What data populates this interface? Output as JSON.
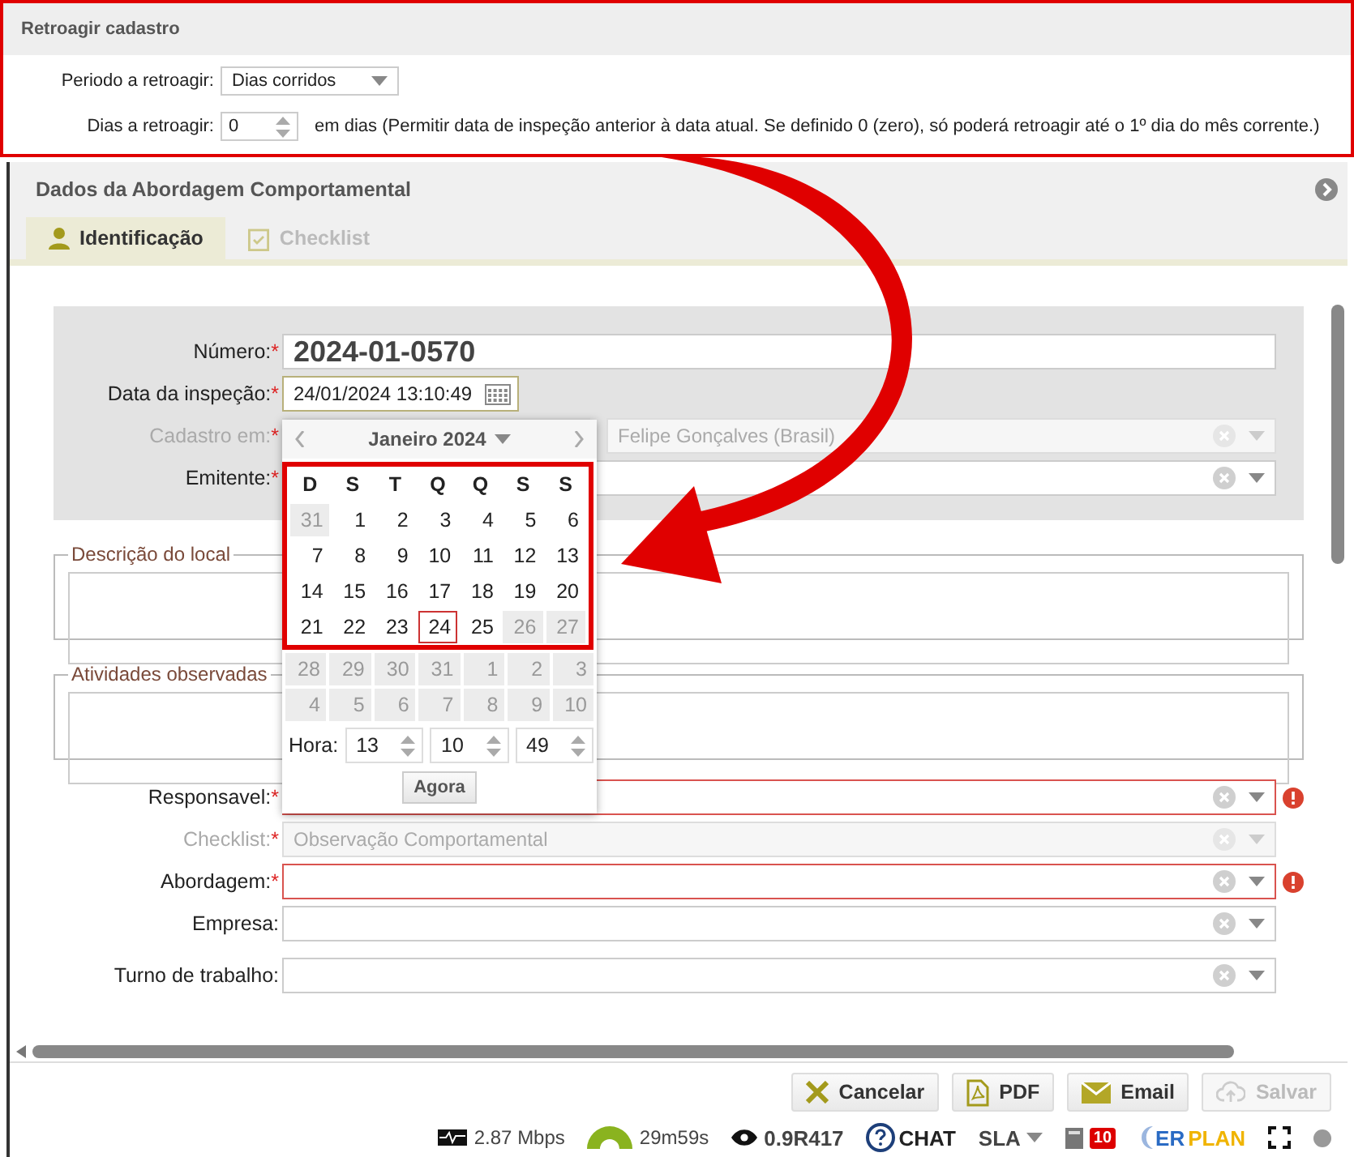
{
  "retro_panel": {
    "title": "Retroagir cadastro",
    "period_label": "Periodo a retroagir:",
    "period_value": "Dias corridos",
    "days_label": "Dias a retroagir:",
    "days_value": "0",
    "days_hint": "em dias (Permitir data de inspeção anterior à data atual. Se definido 0 (zero), só poderá retroagir até o 1º dia do mês corrente.)"
  },
  "panel": {
    "title": "Dados da Abordagem Comportamental"
  },
  "tabs": [
    {
      "label": "Identificação",
      "selected": true,
      "disabled": false
    },
    {
      "label": "Checklist",
      "selected": false,
      "disabled": true
    }
  ],
  "top_fields": [
    {
      "label": "Número:",
      "required_mark": "*",
      "disabled": false,
      "kind": "number",
      "value": "2024-01-0570"
    },
    {
      "label": "Data da inspeção:",
      "required_mark": "*",
      "disabled": false,
      "kind": "date",
      "value": "24/01/2024 13:10:49"
    },
    {
      "label": "Cadastro em:",
      "required_mark": "*",
      "disabled": true,
      "kind": "pair",
      "value": "Felipe Gonçalves (Brasil)"
    },
    {
      "label": "Emitente:",
      "required_mark": "*",
      "disabled": false,
      "kind": "select"
    }
  ],
  "fieldsets": [
    {
      "legend": "Descrição do local"
    },
    {
      "legend": "Atividades observadas"
    }
  ],
  "bottom_fields": [
    {
      "label": "Responsavel:",
      "required_mark": "*",
      "disabled": false,
      "error": true,
      "kind": "select"
    },
    {
      "label": "Checklist:",
      "required_mark": "*",
      "disabled": true,
      "error": false,
      "kind": "select",
      "value": "Observação Comportamental"
    },
    {
      "label": "Abordagem:",
      "required_mark": "*",
      "disabled": false,
      "error": true,
      "kind": "select"
    },
    {
      "label": "Empresa:",
      "disabled": false,
      "error": false,
      "kind": "select"
    },
    {
      "label": "Turno de trabalho:",
      "disabled": false,
      "error": false,
      "kind": "select"
    }
  ],
  "calendar": {
    "month": "Janeiro 2024",
    "weekdays": [
      "D",
      "S",
      "T",
      "Q",
      "Q",
      "S",
      "S"
    ],
    "days": [
      {
        "day": "31",
        "muted": true,
        "selected": false
      },
      {
        "day": "1",
        "muted": false,
        "selected": false
      },
      {
        "day": "2",
        "muted": false,
        "selected": false
      },
      {
        "day": "3",
        "muted": false,
        "selected": false
      },
      {
        "day": "4",
        "muted": false,
        "selected": false
      },
      {
        "day": "5",
        "muted": false,
        "selected": false
      },
      {
        "day": "6",
        "muted": false,
        "selected": false
      },
      {
        "day": "7",
        "muted": false,
        "selected": false
      },
      {
        "day": "8",
        "muted": false,
        "selected": false
      },
      {
        "day": "9",
        "muted": false,
        "selected": false
      },
      {
        "day": "10",
        "muted": false,
        "selected": false
      },
      {
        "day": "11",
        "muted": false,
        "selected": false
      },
      {
        "day": "12",
        "muted": false,
        "selected": false
      },
      {
        "day": "13",
        "muted": false,
        "selected": false
      },
      {
        "day": "14",
        "muted": false,
        "selected": false
      },
      {
        "day": "15",
        "muted": false,
        "selected": false
      },
      {
        "day": "16",
        "muted": false,
        "selected": false
      },
      {
        "day": "17",
        "muted": false,
        "selected": false
      },
      {
        "day": "18",
        "muted": false,
        "selected": false
      },
      {
        "day": "19",
        "muted": false,
        "selected": false
      },
      {
        "day": "20",
        "muted": false,
        "selected": false
      },
      {
        "day": "21",
        "muted": false,
        "selected": false
      },
      {
        "day": "22",
        "muted": false,
        "selected": false
      },
      {
        "day": "23",
        "muted": false,
        "selected": false
      },
      {
        "day": "24",
        "muted": false,
        "selected": true
      },
      {
        "day": "25",
        "muted": false,
        "selected": false
      },
      {
        "day": "26",
        "muted": true,
        "selected": false
      },
      {
        "day": "27",
        "muted": true,
        "selected": false
      },
      {
        "day": "28",
        "muted": true,
        "selected": false
      },
      {
        "day": "29",
        "muted": true,
        "selected": false
      },
      {
        "day": "30",
        "muted": true,
        "selected": false
      },
      {
        "day": "31",
        "muted": true,
        "selected": false
      },
      {
        "day": "1",
        "muted": true,
        "selected": false
      },
      {
        "day": "2",
        "muted": true,
        "selected": false
      },
      {
        "day": "3",
        "muted": true,
        "selected": false
      },
      {
        "day": "4",
        "muted": true,
        "selected": false
      },
      {
        "day": "5",
        "muted": true,
        "selected": false
      },
      {
        "day": "6",
        "muted": true,
        "selected": false
      },
      {
        "day": "7",
        "muted": true,
        "selected": false
      },
      {
        "day": "8",
        "muted": true,
        "selected": false
      },
      {
        "day": "9",
        "muted": true,
        "selected": false
      },
      {
        "day": "10",
        "muted": true,
        "selected": false
      }
    ],
    "time_label": "Hora:",
    "hour": "13",
    "minute": "10",
    "second": "49",
    "now_button": "Agora"
  },
  "footer_buttons": [
    {
      "label": "Cancelar",
      "kind": "cancel",
      "disabled": false
    },
    {
      "label": "PDF",
      "kind": "pdf",
      "disabled": false
    },
    {
      "label": "Email",
      "kind": "email",
      "disabled": false
    },
    {
      "label": "Salvar",
      "kind": "save",
      "disabled": true
    }
  ],
  "status_bar": {
    "speed": "2.87 Mbps",
    "timer": "29m59s",
    "version": "0.9R417",
    "chat": "CHAT",
    "sla": "SLA",
    "badge": "10",
    "logo": [
      "ER",
      "PLAN"
    ]
  }
}
